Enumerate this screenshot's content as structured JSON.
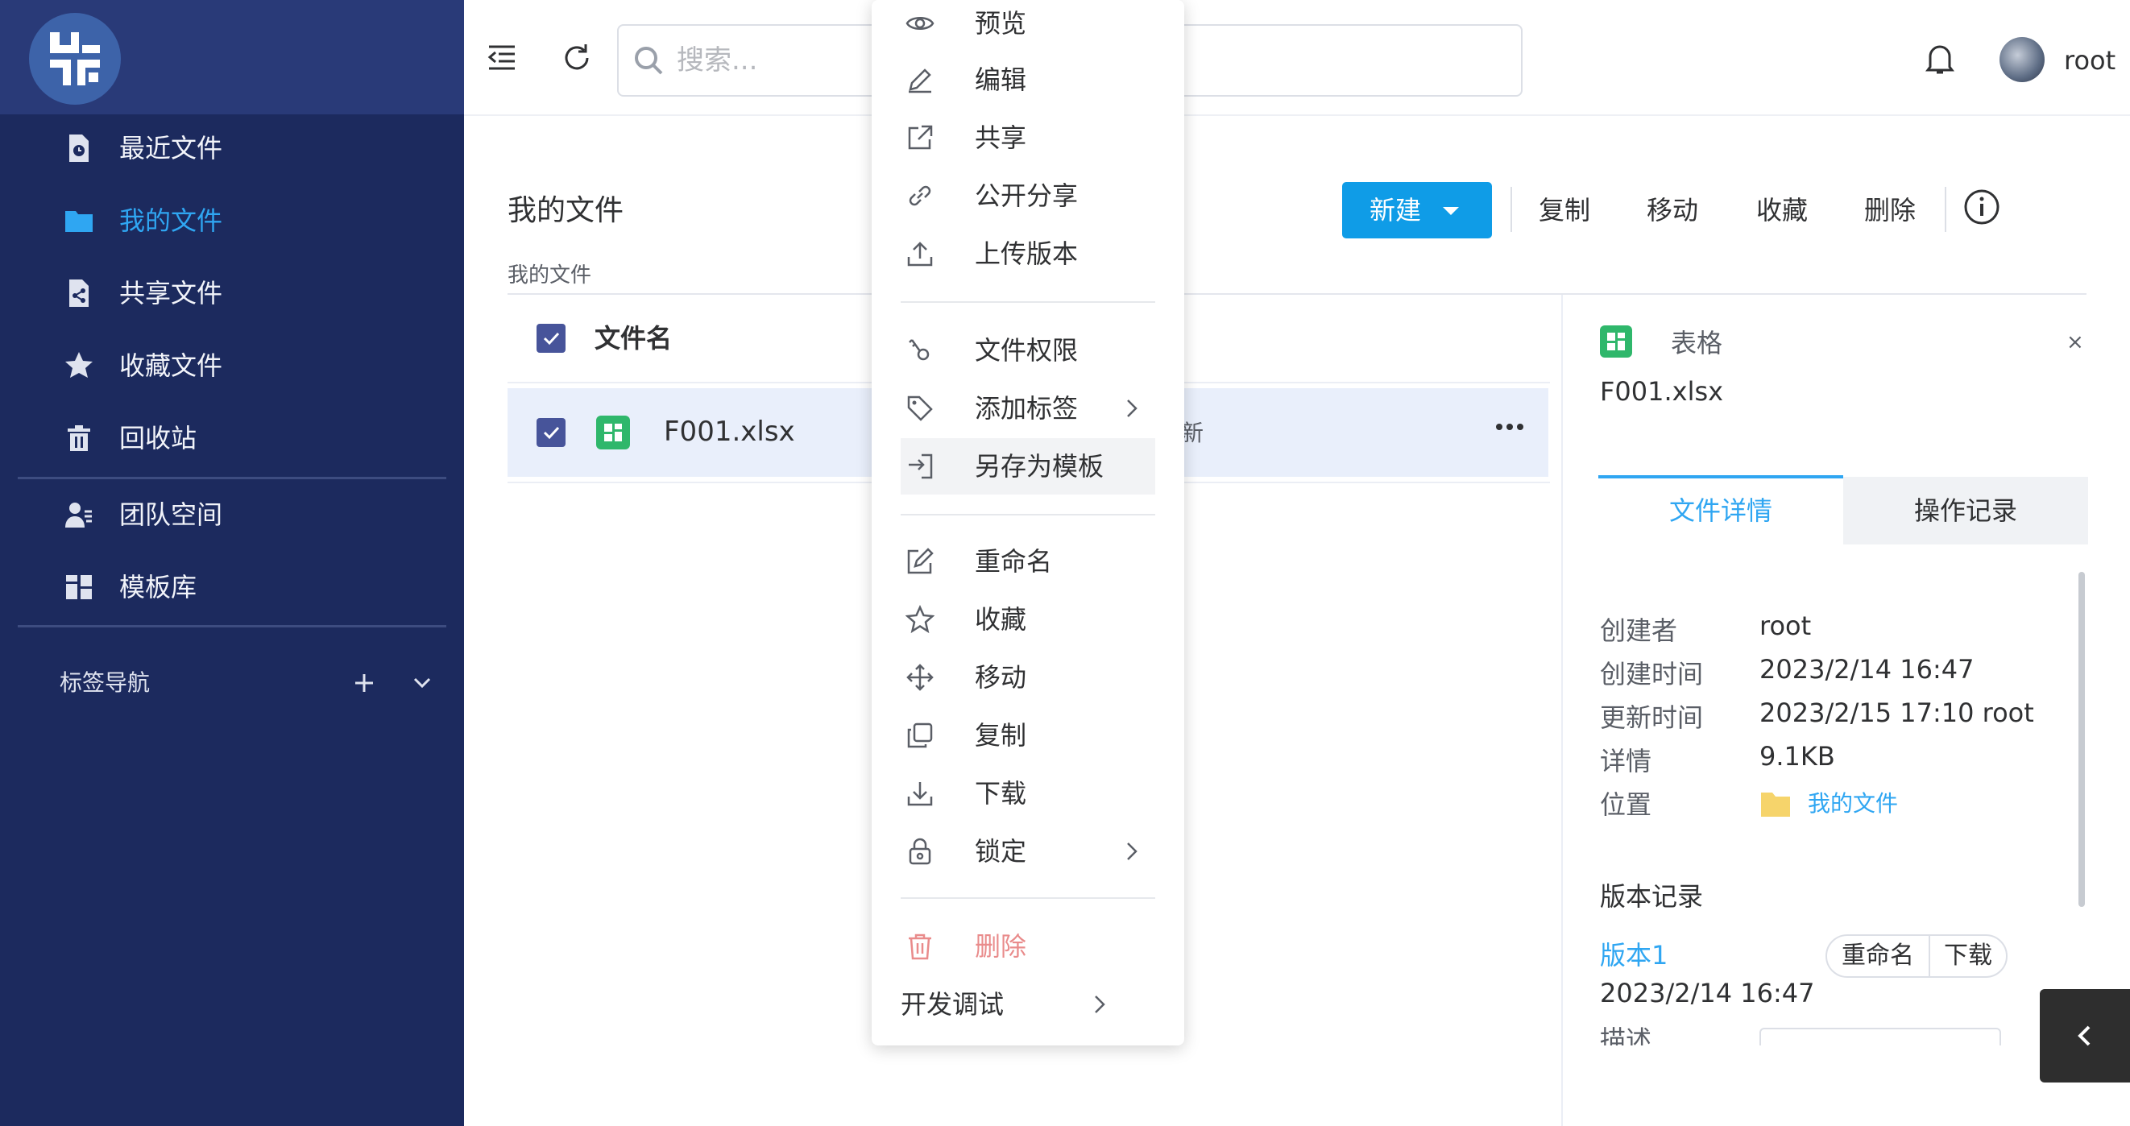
{
  "sidebar": {
    "items": [
      {
        "label": "最近文件",
        "icon": "recent-file-icon"
      },
      {
        "label": "我的文件",
        "icon": "folder-icon",
        "active": true
      },
      {
        "label": "共享文件",
        "icon": "shared-file-icon"
      },
      {
        "label": "收藏文件",
        "icon": "star-icon"
      },
      {
        "label": "回收站",
        "icon": "trash-icon"
      },
      {
        "label": "团队空间",
        "icon": "team-icon"
      },
      {
        "label": "模板库",
        "icon": "template-icon"
      }
    ],
    "tags_label": "标签导航"
  },
  "topbar": {
    "search_placeholder": "搜索...",
    "username": "root"
  },
  "main": {
    "title": "我的文件",
    "breadcrumb": "我的文件",
    "toolbar": {
      "new_label": "新建",
      "copy_label": "复制",
      "move_label": "移动",
      "favorite_label": "收藏",
      "delete_label": "删除"
    },
    "table": {
      "header_name": "文件名",
      "rows": [
        {
          "name": "F001.xlsx",
          "status_partial": "新",
          "checked": true
        }
      ]
    }
  },
  "context_menu": {
    "items": [
      "预览",
      "编辑",
      "共享",
      "公开分享",
      "上传版本",
      "文件权限",
      "添加标签",
      "另存为模板",
      "重命名",
      "收藏",
      "移动",
      "复制",
      "下载",
      "锁定",
      "删除",
      "开发调试"
    ]
  },
  "details": {
    "type_label": "表格",
    "file_name": "F001.xlsx",
    "close": "×",
    "tabs": [
      "文件详情",
      "操作记录"
    ],
    "fields": [
      {
        "label": "创建者",
        "value": "root"
      },
      {
        "label": "创建时间",
        "value": "2023/2/14 16:47"
      },
      {
        "label": "更新时间",
        "value": "2023/2/15 17:10 root"
      },
      {
        "label": "详情",
        "value": "9.1KB"
      },
      {
        "label": "位置",
        "value": "我的文件"
      }
    ],
    "version_heading": "版本记录",
    "version": {
      "name": "版本1",
      "date": "2023/2/14 16:47",
      "rename_label": "重命名",
      "download_label": "下载"
    },
    "desc_label": "描述"
  },
  "colors": {
    "sidebar": "#1c2a5e",
    "accent": "#2fa6f2",
    "primary_button": "#0f9ce7",
    "danger": "#e98b8b",
    "selected_row": "#e9effb"
  }
}
